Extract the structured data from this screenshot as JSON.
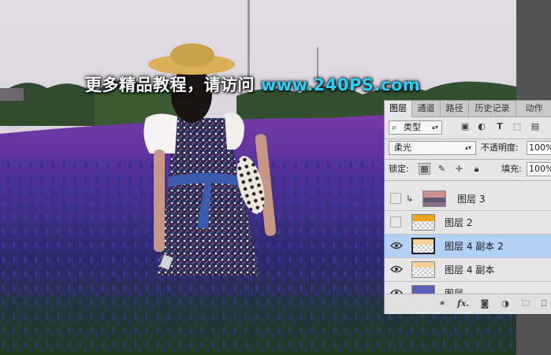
{
  "watermark": {
    "text": "更多精品教程，请访问 ",
    "url": "www.240PS.com"
  },
  "panel": {
    "tabs": [
      {
        "label": "图层",
        "active": true
      },
      {
        "label": "通道",
        "active": false
      },
      {
        "label": "路径",
        "active": false
      },
      {
        "label": "历史记录",
        "active": false
      },
      {
        "label": "动作",
        "active": false
      }
    ],
    "filter": {
      "icon": "search-icon",
      "label": "类型"
    },
    "filter_icons": [
      "image-filter-icon",
      "adjustment-filter-icon",
      "type-filter-icon",
      "shape-filter-icon",
      "smart-object-filter-icon"
    ],
    "blend_mode": "柔光",
    "opacity_label": "不透明度:",
    "opacity_value": "100%",
    "lock_label": "锁定:",
    "lock_icons": [
      "lock-transparent-pixels-icon",
      "lock-image-pixels-icon",
      "lock-position-icon",
      "lock-all-icon"
    ],
    "fill_label": "填充:",
    "fill_value": "100%",
    "layers": [
      {
        "name": "图层 3",
        "visible": false,
        "clipped": true,
        "selected": false,
        "thumb": "sky"
      },
      {
        "name": "图层 2",
        "visible": false,
        "clipped": false,
        "selected": false,
        "thumb": "yellow"
      },
      {
        "name": "图层 4 副本 2",
        "visible": true,
        "clipped": false,
        "selected": true,
        "thumb": "light-yellow"
      },
      {
        "name": "图层 4 副本",
        "visible": true,
        "clipped": false,
        "selected": false,
        "thumb": "light-yellow"
      },
      {
        "name": "图层",
        "visible": true,
        "clipped": false,
        "selected": false,
        "thumb": "blue"
      }
    ],
    "bottom_icons": [
      "link-layers-icon",
      "fx-icon",
      "add-mask-icon",
      "adjustment-layer-icon",
      "new-group-icon",
      "new-layer-icon"
    ],
    "bottom_fx": "fx."
  },
  "colors": {
    "selected_row": "#b3d0f5",
    "panel_bg": "#e6e6e6",
    "url": "#25d3ff"
  }
}
